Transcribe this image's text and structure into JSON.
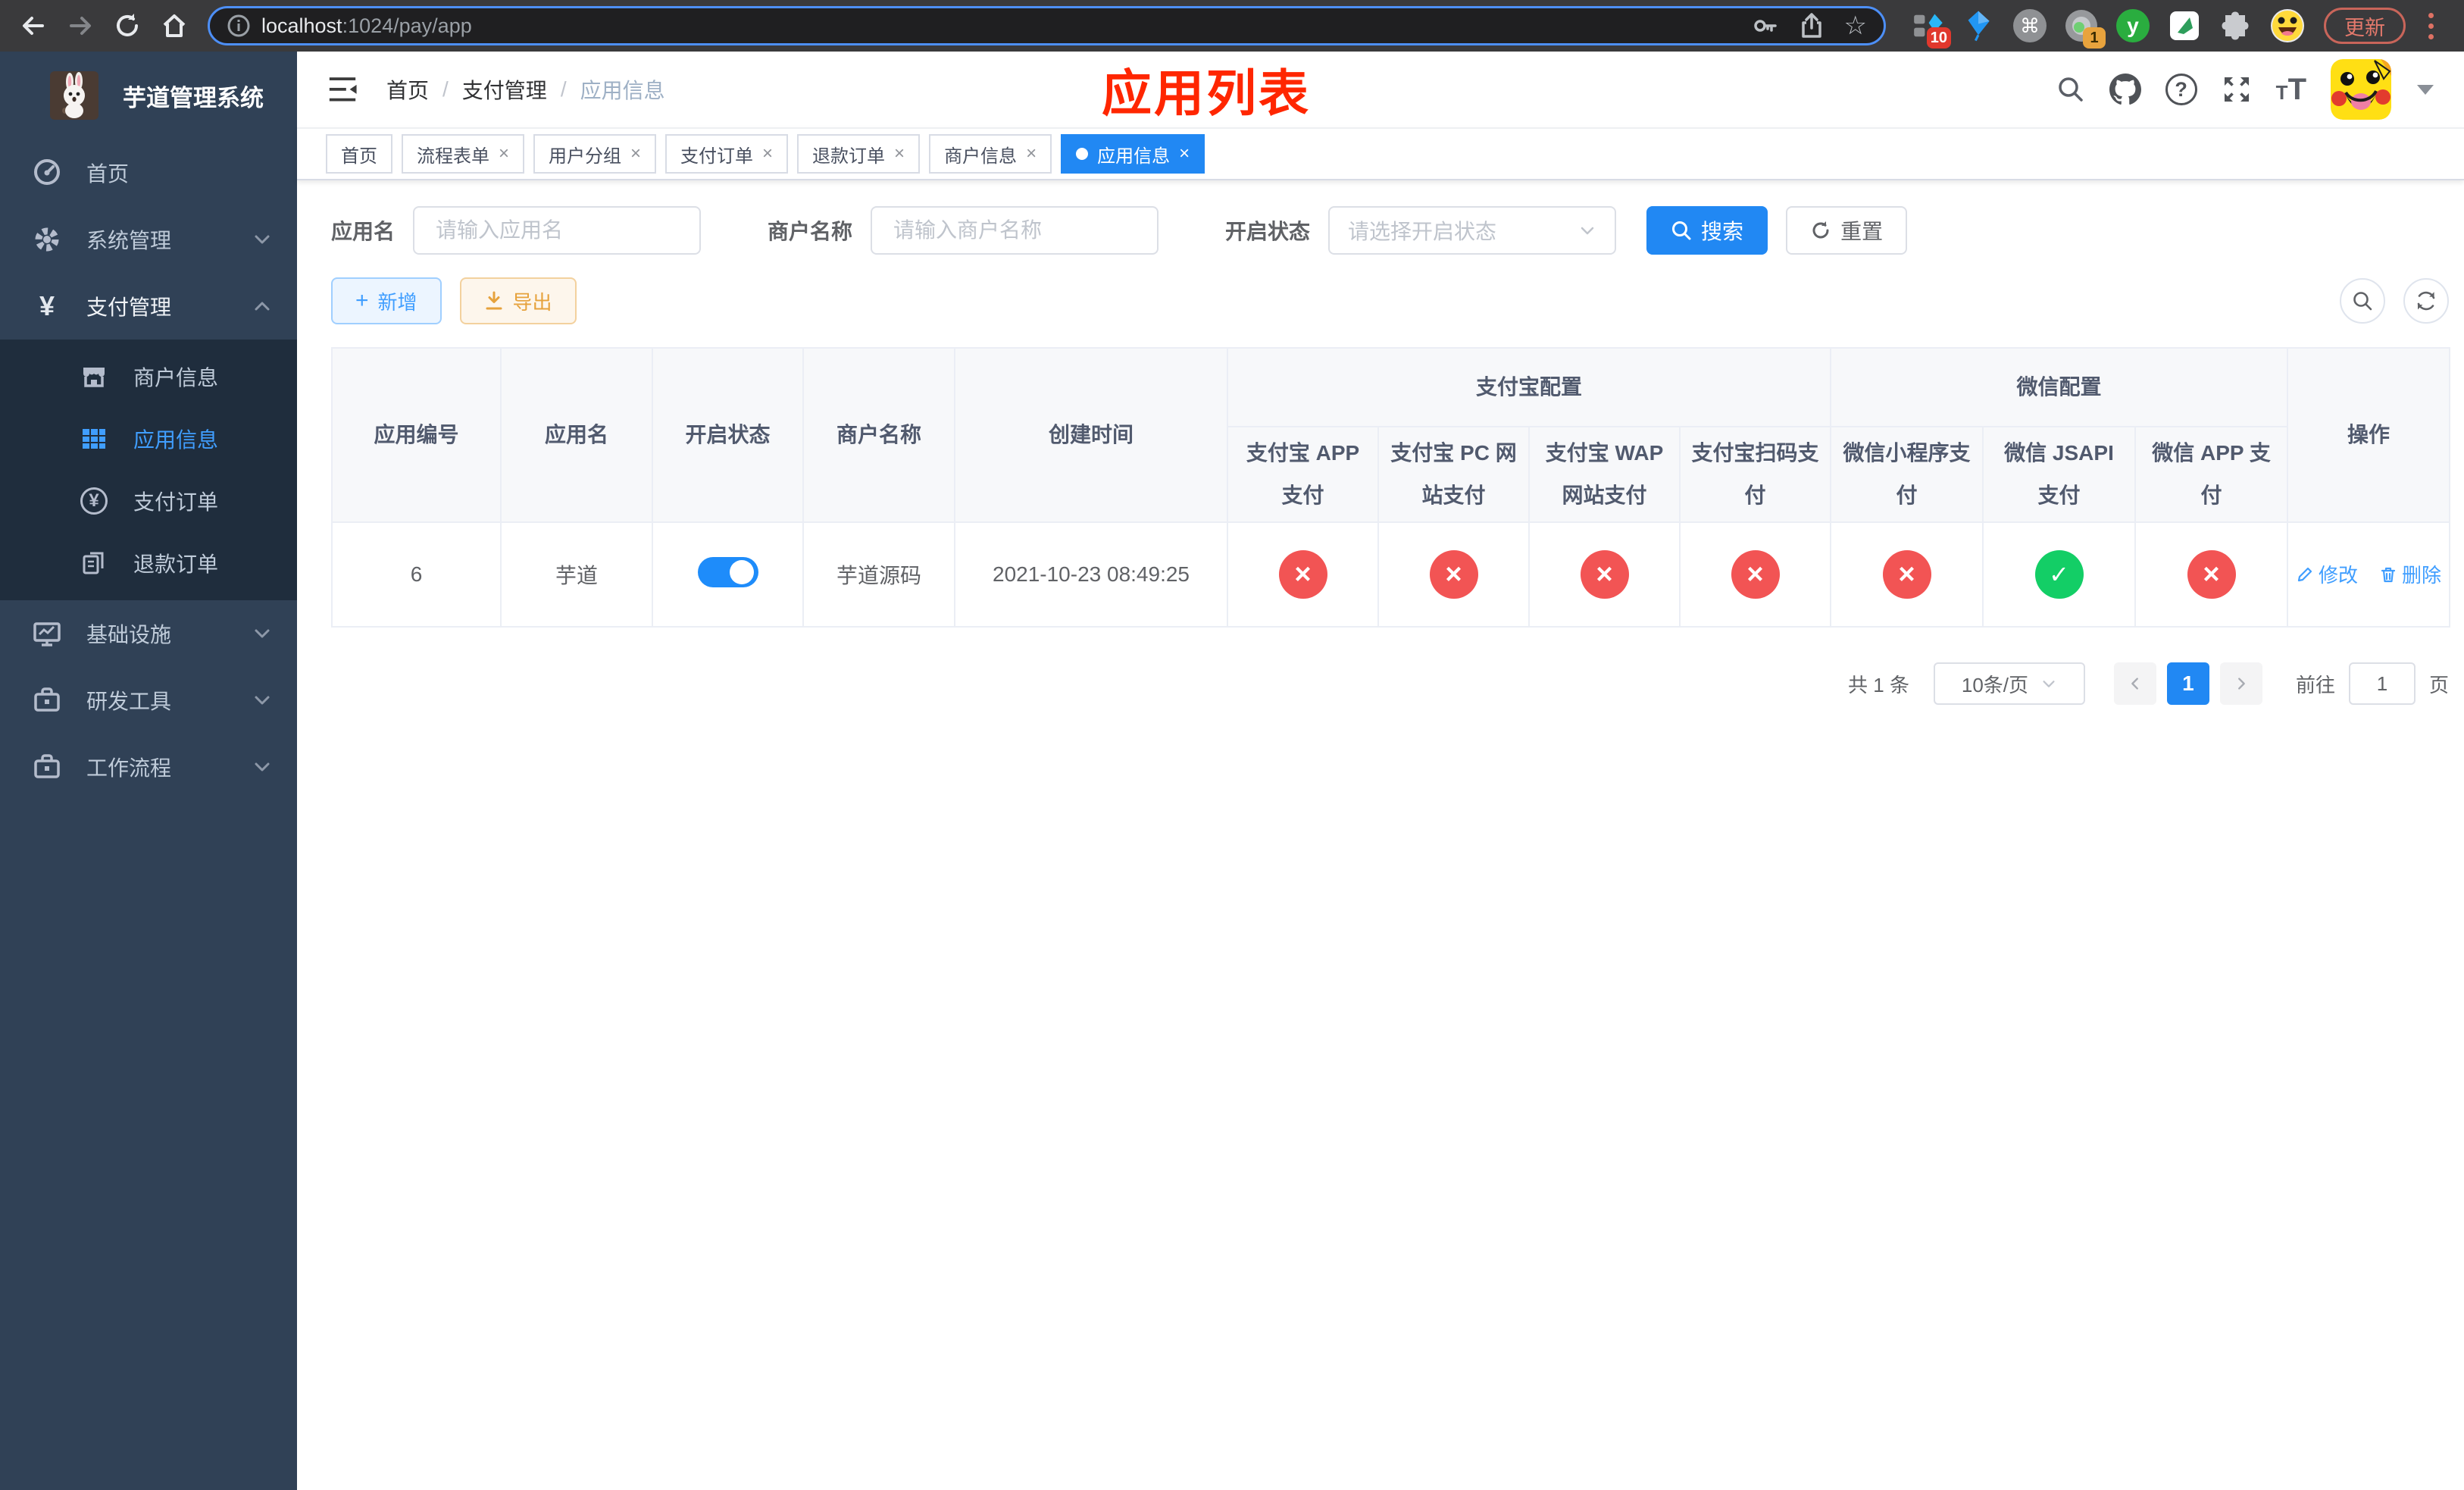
{
  "browser": {
    "url_host": "localhost",
    "url_path": ":1024/pay/app",
    "update_label": "更新",
    "ext_badge_grid": "10",
    "ext_badge_session": "1",
    "ext_letter": "y"
  },
  "icons": {
    "star": "☆",
    "command": "⌘",
    "yen": "¥",
    "question": "?",
    "plus": "+",
    "close": "×",
    "font_small": "T",
    "font_large": "T"
  },
  "sidebar": {
    "title": "芋道管理系统",
    "menu": [
      {
        "label": "首页"
      },
      {
        "label": "系统管理"
      },
      {
        "label": "支付管理"
      },
      {
        "label": "基础设施"
      },
      {
        "label": "研发工具"
      },
      {
        "label": "工作流程"
      }
    ],
    "payment_submenu": [
      {
        "label": "商户信息",
        "state": ""
      },
      {
        "label": "应用信息",
        "state": "active"
      },
      {
        "label": "支付订单",
        "state": ""
      },
      {
        "label": "退款订单",
        "state": ""
      }
    ]
  },
  "navbar": {
    "breadcrumb": [
      "首页",
      "支付管理",
      "应用信息"
    ],
    "separator": "/",
    "annotation_title": "应用列表"
  },
  "tabs": [
    {
      "label": "首页",
      "state": ""
    },
    {
      "label": "流程表单",
      "state": ""
    },
    {
      "label": "用户分组",
      "state": ""
    },
    {
      "label": "支付订单",
      "state": ""
    },
    {
      "label": "退款订单",
      "state": ""
    },
    {
      "label": "商户信息",
      "state": ""
    },
    {
      "label": "应用信息",
      "state": "active"
    }
  ],
  "filters": {
    "app_name_label": "应用名",
    "app_name_placeholder": "请输入应用名",
    "merchant_name_label": "商户名称",
    "merchant_name_placeholder": "请输入商户名称",
    "status_label": "开启状态",
    "status_placeholder": "请选择开启状态",
    "search_label": "搜索",
    "reset_label": "重置"
  },
  "toolbar": {
    "add_label": "新增",
    "export_label": "导出"
  },
  "table": {
    "headers": {
      "app_id": "应用编号",
      "app_name": "应用名",
      "status": "开启状态",
      "merchant": "商户名称",
      "created": "创建时间",
      "alipay_group": "支付宝配置",
      "wechat_group": "微信配置",
      "alipay_app": "支付宝 APP 支付",
      "alipay_pc": "支付宝 PC 网站支付",
      "alipay_wap": "支付宝 WAP 网站支付",
      "alipay_qr": "支付宝扫码支付",
      "wx_mini": "微信小程序支付",
      "wx_jsapi": "微信 JSAPI 支付",
      "wx_app": "微信 APP 支付",
      "actions": "操作"
    },
    "row": {
      "app_id": "6",
      "app_name": "芋道",
      "switch_state": "on",
      "merchant": "芋道源码",
      "created": "2021-10-23 08:49:25",
      "pay_statuses": [
        "no",
        "no",
        "no",
        "no",
        "no",
        "yes",
        "no"
      ],
      "edit_label": "修改",
      "delete_label": "删除"
    }
  },
  "pagination": {
    "total_label": "共 1 条",
    "page_size": "10条/页",
    "current_page": "1",
    "goto_label": "前往",
    "goto_value": "1",
    "page_label": "页"
  },
  "colors": {
    "primary": "#2188f3",
    "link": "#409eff",
    "success": "#13ce66",
    "danger": "#f25454",
    "warning": "#e6a23c",
    "annotation": "#ff2600",
    "sidebar_bg": "#304156",
    "submenu_bg": "#1f2d3d"
  }
}
